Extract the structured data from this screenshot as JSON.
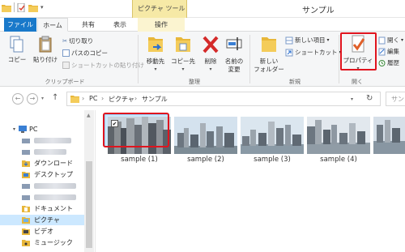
{
  "title_bar": {
    "context_tab_group": "ピクチャ ツール",
    "window_title": "サンプル"
  },
  "tabs": {
    "file": "ファイル",
    "home": "ホーム",
    "share": "共有",
    "view": "表示",
    "manage": "操作"
  },
  "ribbon": {
    "clipboard": {
      "copy": "コピー",
      "paste": "貼り付け",
      "cut": "切り取り",
      "copy_path": "パスのコピー",
      "paste_shortcut": "ショートカットの貼り付け",
      "group_label": "クリップボード"
    },
    "organize": {
      "move_to": "移動先",
      "copy_to": "コピー先",
      "delete": "削除",
      "rename_line1": "名前の",
      "rename_line2": "変更",
      "group_label": "整理"
    },
    "new": {
      "new_folder_line1": "新しい",
      "new_folder_line2": "フォルダー",
      "new_item": "新しい項目",
      "shortcut": "ショートカット",
      "group_label": "新規"
    },
    "open": {
      "properties": "プロパティ",
      "open": "開く",
      "edit": "編集",
      "history": "履歴",
      "group_label": "開く"
    }
  },
  "address_bar": {
    "crumbs": [
      "PC",
      "ピクチャ",
      "サンプル"
    ],
    "search_placeholder": "サン"
  },
  "nav_pane": {
    "items": [
      {
        "label": "PC",
        "type": "pc"
      },
      {
        "label": "",
        "type": "drive-redacted"
      },
      {
        "label": "",
        "type": "drive-redacted"
      },
      {
        "label": "ダウンロード",
        "type": "folder"
      },
      {
        "label": "デスクトップ",
        "type": "folder"
      },
      {
        "label": "",
        "type": "drive-redacted"
      },
      {
        "label": "",
        "type": "drive-redacted"
      },
      {
        "label": "ドキュメント",
        "type": "folder"
      },
      {
        "label": "ピクチャ",
        "type": "folder",
        "selected": true
      },
      {
        "label": "ビデオ",
        "type": "folder"
      },
      {
        "label": "ミュージック",
        "type": "folder"
      }
    ]
  },
  "files": [
    {
      "name": "sample (1)",
      "selected": true,
      "checked": "✔"
    },
    {
      "name": "sample (2)",
      "selected": false
    },
    {
      "name": "sample (3)",
      "selected": false
    },
    {
      "name": "sample (4)",
      "selected": false
    },
    {
      "name": "",
      "selected": false
    }
  ],
  "colors": {
    "accent": "#1979ca",
    "highlight_red": "#e0141e",
    "selection_bg": "#cce8ff",
    "context_tab": "#f6e9a6"
  }
}
